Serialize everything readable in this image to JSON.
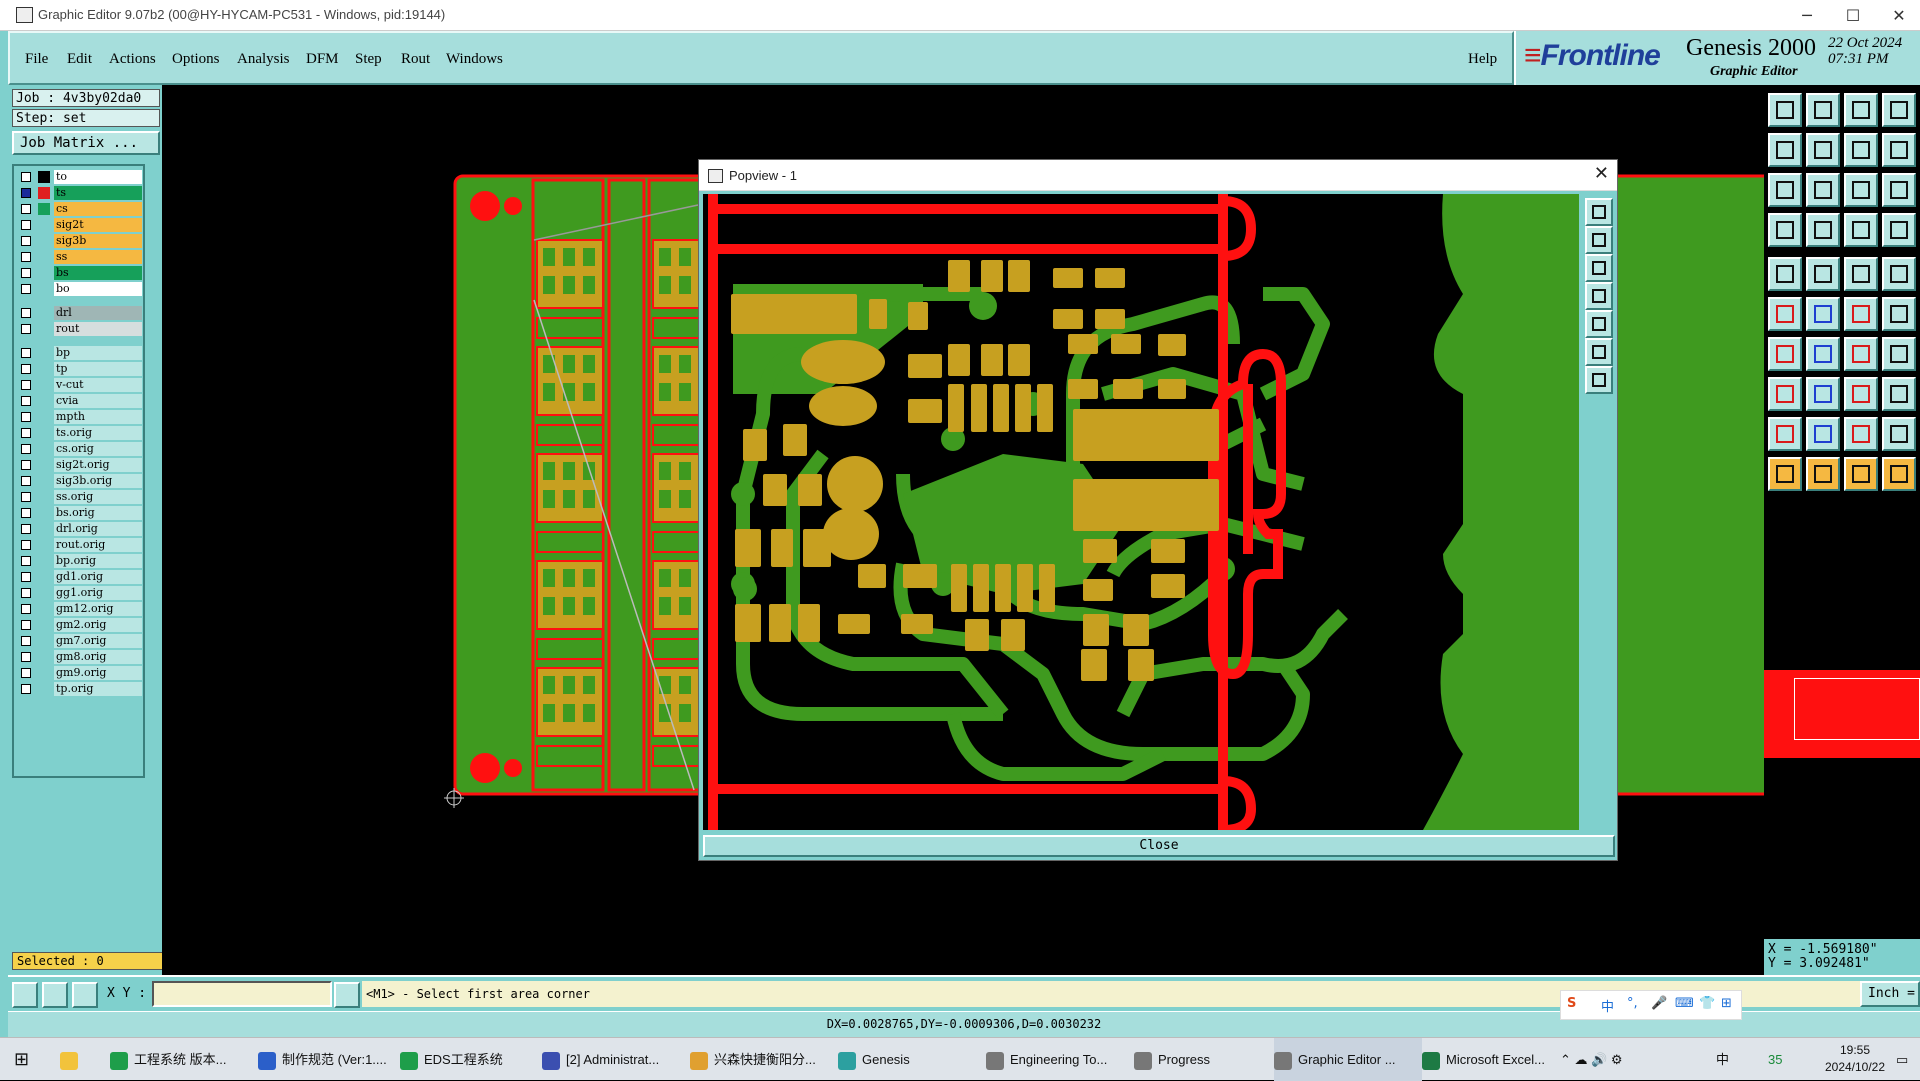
{
  "window": {
    "title": "Graphic Editor 9.07b2 (00@HY-HYCAM-PC531 - Windows, pid:19144)",
    "minimize": "─",
    "maximize": "☐",
    "close": "✕"
  },
  "menu": {
    "items": [
      "File",
      "Edit",
      "Actions",
      "Options",
      "Analysis",
      "DFM",
      "Step",
      "Rout",
      "Windows"
    ],
    "help": "Help"
  },
  "brand": {
    "logo_text": "Frontline",
    "product": "Genesis 2000",
    "subtitle": "Graphic Editor",
    "date": "22 Oct 2024",
    "time": "07:31 PM"
  },
  "job": {
    "job_line": "Job : 4v3by02da0",
    "step_line": "Step: set",
    "matrix_button": "Job Matrix ..."
  },
  "layers": [
    {
      "name": "to",
      "color": "#ffffff",
      "swatch": "#000000",
      "checked": false
    },
    {
      "name": "ts",
      "color": "#16a05a",
      "swatch": "#e02020",
      "checked": true
    },
    {
      "name": "cs",
      "color": "#f5b841",
      "swatch": "#16a05a",
      "checked": false
    },
    {
      "name": "sig2t",
      "color": "#f5b841",
      "swatch": "#7fd0cd",
      "checked": false
    },
    {
      "name": "sig3b",
      "color": "#f5b841",
      "swatch": "#7fd0cd",
      "checked": false
    },
    {
      "name": "ss",
      "color": "#f5b841",
      "swatch": "#7fd0cd",
      "checked": false
    },
    {
      "name": "bs",
      "color": "#16a05a",
      "swatch": "#7fd0cd",
      "checked": false
    },
    {
      "name": "bo",
      "color": "#ffffff",
      "swatch": "#7fd0cd",
      "checked": false
    },
    {
      "name": "drl",
      "color": "#9fb6b5",
      "swatch": "#7fd0cd",
      "checked": false
    },
    {
      "name": "rout",
      "color": "#d6dede",
      "swatch": "#7fd0cd",
      "checked": false
    },
    {
      "name": "bp",
      "color": "#b9e6e3",
      "swatch": "#7fd0cd",
      "checked": false
    },
    {
      "name": "tp",
      "color": "#b9e6e3",
      "swatch": "#7fd0cd",
      "checked": false
    },
    {
      "name": "v-cut",
      "color": "#b9e6e3",
      "swatch": "#7fd0cd",
      "checked": false
    },
    {
      "name": "cvia",
      "color": "#b9e6e3",
      "swatch": "#7fd0cd",
      "checked": false
    },
    {
      "name": "mpth",
      "color": "#b9e6e3",
      "swatch": "#7fd0cd",
      "checked": false
    },
    {
      "name": "ts.orig",
      "color": "#b9e6e3",
      "swatch": "#7fd0cd",
      "checked": false
    },
    {
      "name": "cs.orig",
      "color": "#b9e6e3",
      "swatch": "#7fd0cd",
      "checked": false
    },
    {
      "name": "sig2t.orig",
      "color": "#b9e6e3",
      "swatch": "#7fd0cd",
      "checked": false
    },
    {
      "name": "sig3b.orig",
      "color": "#b9e6e3",
      "swatch": "#7fd0cd",
      "checked": false
    },
    {
      "name": "ss.orig",
      "color": "#b9e6e3",
      "swatch": "#7fd0cd",
      "checked": false
    },
    {
      "name": "bs.orig",
      "color": "#b9e6e3",
      "swatch": "#7fd0cd",
      "checked": false
    },
    {
      "name": "drl.orig",
      "color": "#b9e6e3",
      "swatch": "#7fd0cd",
      "checked": false
    },
    {
      "name": "rout.orig",
      "color": "#b9e6e3",
      "swatch": "#7fd0cd",
      "checked": false
    },
    {
      "name": "bp.orig",
      "color": "#b9e6e3",
      "swatch": "#7fd0cd",
      "checked": false
    },
    {
      "name": "gd1.orig",
      "color": "#b9e6e3",
      "swatch": "#7fd0cd",
      "checked": false
    },
    {
      "name": "gg1.orig",
      "color": "#b9e6e3",
      "swatch": "#7fd0cd",
      "checked": false
    },
    {
      "name": "gm12.orig",
      "color": "#b9e6e3",
      "swatch": "#7fd0cd",
      "checked": false
    },
    {
      "name": "gm2.orig",
      "color": "#b9e6e3",
      "swatch": "#7fd0cd",
      "checked": false
    },
    {
      "name": "gm7.orig",
      "color": "#b9e6e3",
      "swatch": "#7fd0cd",
      "checked": false
    },
    {
      "name": "gm8.orig",
      "color": "#b9e6e3",
      "swatch": "#7fd0cd",
      "checked": false
    },
    {
      "name": "gm9.orig",
      "color": "#b9e6e3",
      "swatch": "#7fd0cd",
      "checked": false
    },
    {
      "name": "tp.orig",
      "color": "#b9e6e3",
      "swatch": "#7fd0cd",
      "checked": false
    }
  ],
  "selected": "Selected : 0",
  "coords": {
    "x": "X = -1.569180\"",
    "y": "Y = 3.092481\""
  },
  "command": {
    "xy_label": "X Y :",
    "xy_value": "",
    "prompt": "<M1> - Select first area corner",
    "unit": "Inch ="
  },
  "status": "DX=0.0028765,DY=-0.0009306,D=0.0030232",
  "popview": {
    "title": "Popview - 1",
    "close_label": "Close",
    "close_x": "✕"
  },
  "ime": {
    "items": [
      "中",
      "°,",
      "🎤",
      "⌨",
      "👕",
      "⊞"
    ]
  },
  "taskbar": {
    "items": [
      {
        "label": "工程系统   版本...",
        "color": "#1e9e4a"
      },
      {
        "label": "制作规范 (Ver:1....",
        "color": "#2b5fc9"
      },
      {
        "label": "EDS工程系统",
        "color": "#1e9e4a"
      },
      {
        "label": "[2] Administrat...",
        "color": "#3b4fb0"
      },
      {
        "label": "兴森快捷衡阳分...",
        "color": "#e0a030"
      },
      {
        "label": "Genesis",
        "color": "#2ca0a0"
      },
      {
        "label": "Engineering To...",
        "color": "#777777"
      },
      {
        "label": "Progress",
        "color": "#777777"
      },
      {
        "label": "Graphic Editor ...",
        "color": "#777777"
      },
      {
        "label": "Microsoft Excel...",
        "color": "#1d7a44"
      }
    ],
    "tray": "35",
    "tray_ime": "中",
    "time": "19:55",
    "date": "2024/10/22"
  },
  "colors": {
    "panel_teal": "#7fd0cd",
    "copper_green": "#3f9a1f",
    "rout_red": "#ff1010",
    "pad_gold": "#c7a020"
  }
}
